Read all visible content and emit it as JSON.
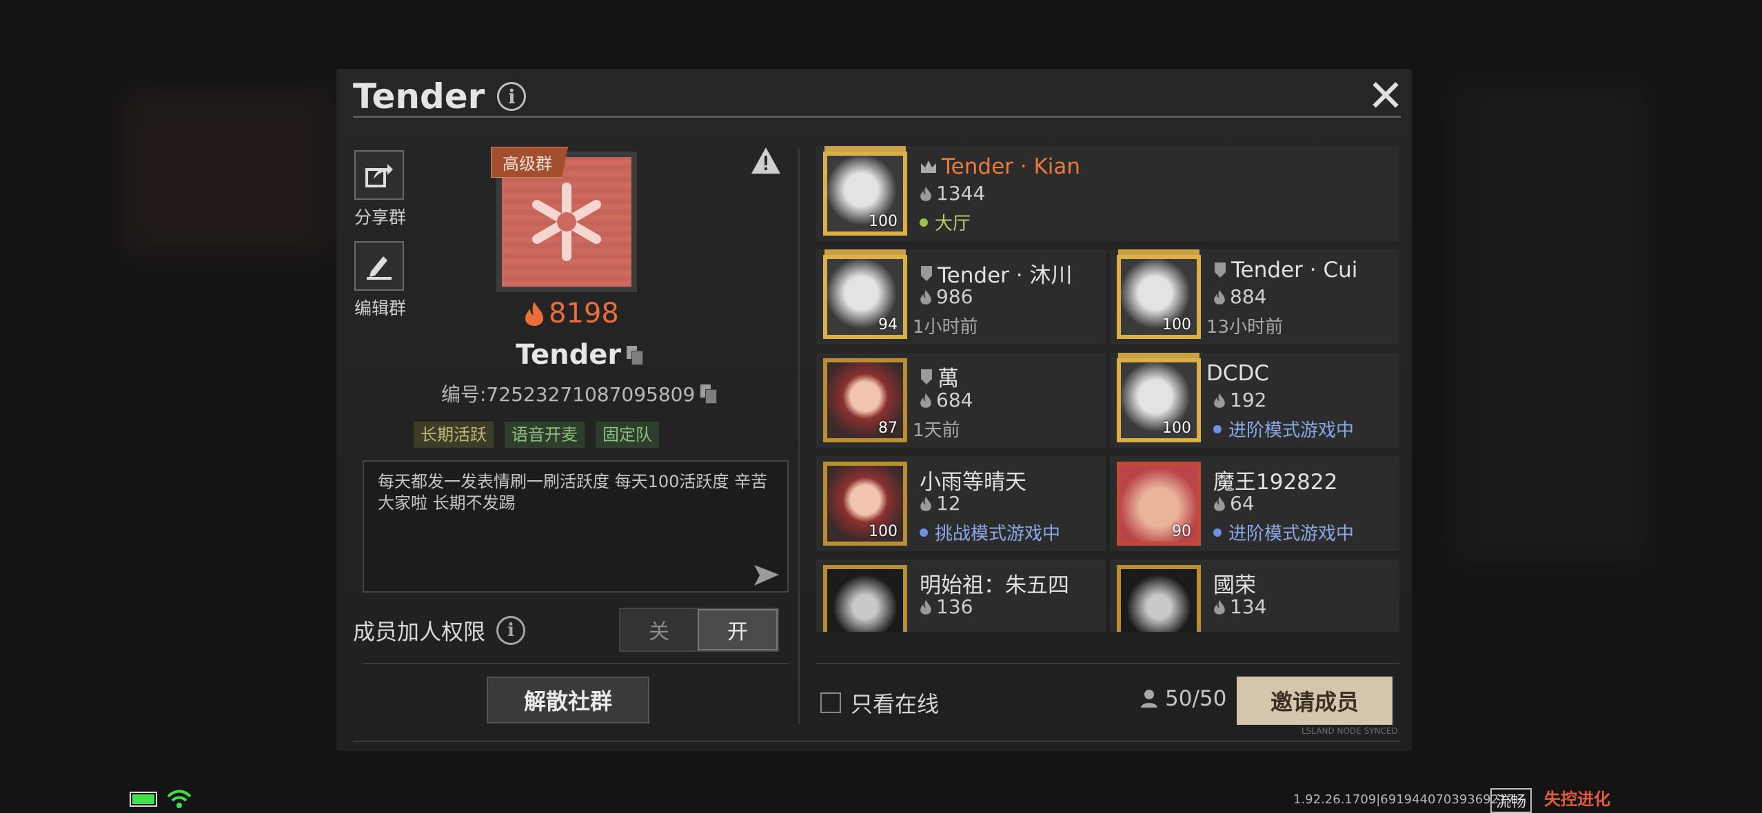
{
  "header": {
    "title": "Tender",
    "close": "✕"
  },
  "side": {
    "share_label": "分享群",
    "edit_label": "编辑群"
  },
  "group": {
    "badge": "高级群",
    "heat": "8198",
    "name": "Tender",
    "id_text": "编号:72523271087095809",
    "tags": [
      "长期活跃",
      "语音开麦",
      "固定队"
    ],
    "description": "每天都发一发表情刷一刷活跃度 每天100活跃度  辛苦大家啦 长期不发踢"
  },
  "permission": {
    "label": "成员加人权限",
    "off": "关",
    "on": "开",
    "value": "开"
  },
  "disband": "解散社群",
  "members": [
    {
      "name": "Tender · Kian",
      "heat": "1344",
      "status": "大厅",
      "level": "100",
      "role": "owner"
    },
    {
      "name": "Tender · 沐川",
      "heat": "986",
      "status": "1小时前",
      "level": "94",
      "role": "admin"
    },
    {
      "name": "Tender · Cui",
      "heat": "884",
      "status": "13小时前",
      "level": "100",
      "role": "admin"
    },
    {
      "name": "萬",
      "heat": "684",
      "status": "1天前",
      "level": "87",
      "role": "admin"
    },
    {
      "name": "DCDC",
      "heat": "192",
      "status": "进阶模式游戏中",
      "level": "100",
      "role": "member"
    },
    {
      "name": "小雨等晴天",
      "heat": "12",
      "status": "挑战模式游戏中",
      "level": "100",
      "role": "member"
    },
    {
      "name": "魔王192822",
      "heat": "64",
      "status": "进阶模式游戏中",
      "level": "90",
      "role": "member"
    },
    {
      "name": "明始祖：朱五四",
      "heat": "136",
      "status": "",
      "level": "",
      "role": "member"
    },
    {
      "name": "國荣",
      "heat": "134",
      "status": "",
      "level": "",
      "role": "member"
    }
  ],
  "footer": {
    "online_only": "只看在线",
    "count": "50/50",
    "invite": "邀请成员",
    "synced": "LSLAND NODE SYNCED"
  },
  "system": {
    "version": "1.92.26.1709|69194407039369217",
    "quality": "流畅",
    "logo": "失控进化"
  },
  "colors": {
    "accent": "#ea6e3a",
    "invite_bg": "#d5c7ad",
    "online_green": "#9bc24a",
    "in_game_blue": "#6f92e0"
  }
}
